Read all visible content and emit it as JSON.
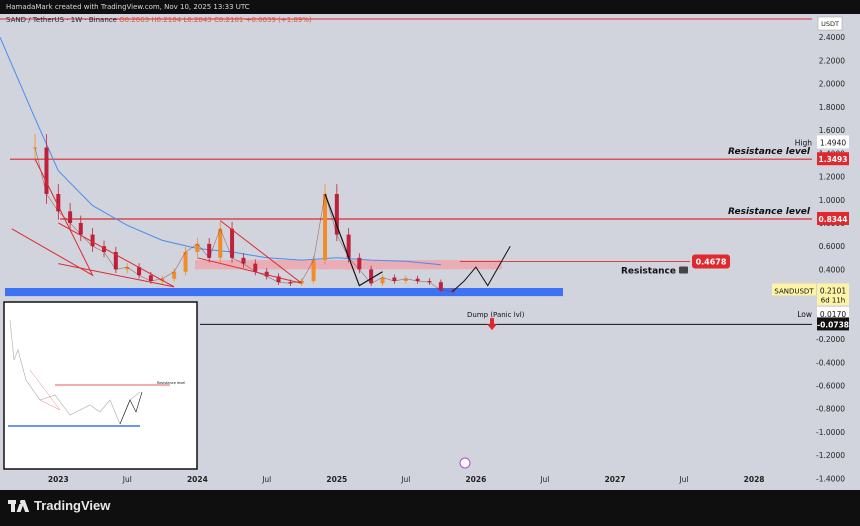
{
  "header": {
    "watermark": "HamadaMark created with TradingView.com, Nov 10, 2025 13:33 UTC",
    "symbol": "SAND / TetherUS · 1W · Binance",
    "ohlc": "O0.2063 H0.2104 L0.2043 C0.2101 +0.0039 (+1.89%)"
  },
  "footer": {
    "brand": "TradingView"
  },
  "colors": {
    "background": "#d1d4dc",
    "resistance_red": "#e0282f",
    "support_blue": "#3d72f5",
    "zone_pink": "#f2a0a8",
    "ma_blue": "#4a8cf0",
    "price_label_yellow": "#fdf3a7"
  },
  "chart_data": {
    "type": "line",
    "title": "SAND / TetherUS · 1W · Binance",
    "currency": "USDT",
    "y_ticks": [
      "2.4000",
      "2.2000",
      "2.0000",
      "1.8000",
      "1.6000",
      "1.4000",
      "1.2000",
      "1.0000",
      "0.8000",
      "0.6000",
      "0.4000",
      "0.2000",
      "0.0000",
      "-0.2000",
      "-0.4000",
      "-0.6000",
      "-0.8000",
      "-1.0000",
      "-1.2000",
      "-1.4000"
    ],
    "ylim": [
      -1.5,
      2.6
    ],
    "x_ticks": [
      "2023",
      "Jul",
      "2024",
      "Jul",
      "2025",
      "Jul",
      "2026",
      "Jul",
      "2027",
      "Jul",
      "2028"
    ],
    "price_series": {
      "x": [
        "2022-11",
        "2022-12",
        "2023-01",
        "2023-02",
        "2023-03",
        "2023-04",
        "2023-05",
        "2023-06",
        "2023-07",
        "2023-08",
        "2023-09",
        "2023-10",
        "2023-11",
        "2023-12",
        "2024-01",
        "2024-02",
        "2024-03",
        "2024-04",
        "2024-05",
        "2024-06",
        "2024-07",
        "2024-08",
        "2024-09",
        "2024-10",
        "2024-11",
        "2024-12",
        "2025-01",
        "2025-02",
        "2025-03",
        "2025-04",
        "2025-05",
        "2025-06",
        "2025-07",
        "2025-08",
        "2025-09",
        "2025-10",
        "2025-11"
      ],
      "y": [
        1.45,
        1.05,
        0.9,
        0.8,
        0.7,
        0.6,
        0.55,
        0.4,
        0.42,
        0.35,
        0.3,
        0.32,
        0.38,
        0.55,
        0.62,
        0.5,
        0.75,
        0.5,
        0.45,
        0.38,
        0.34,
        0.29,
        0.28,
        0.3,
        0.48,
        1.05,
        0.7,
        0.5,
        0.4,
        0.28,
        0.33,
        0.3,
        0.32,
        0.3,
        0.29,
        0.22,
        0.21
      ]
    },
    "moving_average": {
      "x": [
        "2022-08",
        "2022-11",
        "2023-01",
        "2023-04",
        "2023-07",
        "2023-10",
        "2024-01",
        "2024-04",
        "2024-07",
        "2024-10",
        "2025-01",
        "2025-04",
        "2025-07",
        "2025-10"
      ],
      "y": [
        2.4,
        1.7,
        1.25,
        0.95,
        0.78,
        0.65,
        0.58,
        0.55,
        0.5,
        0.48,
        0.5,
        0.48,
        0.47,
        0.44
      ]
    },
    "levels": [
      {
        "label": "Resistance level",
        "value": 1.3493,
        "price_tag": "1.3493"
      },
      {
        "label": "Resistance level",
        "value": 0.8344,
        "price_tag": "0.8344"
      },
      {
        "label": "Resistance",
        "value": 0.4678,
        "price_tag": "0.4678"
      }
    ],
    "support_zone": [
      0.17,
      0.24
    ],
    "resistance_zone": [
      0.4,
      0.48
    ],
    "projection": {
      "x": [
        "2025-11",
        "2025-12",
        "2026-01",
        "2026-02",
        "2026-04"
      ],
      "y": [
        0.21,
        0.3,
        0.42,
        0.26,
        0.6
      ]
    },
    "annotation": "Dump (Panic lvl)",
    "panic_level": {
      "value": -0.0738,
      "price_tag": "-0.0738"
    },
    "high": {
      "label": "High",
      "value": "1.4940"
    },
    "low": {
      "label": "Low",
      "value": "0.0170"
    },
    "last_price": {
      "symbol": "SANDUSDT",
      "value": "0.2101",
      "countdown": "6d 11h"
    },
    "inset_labels": [
      "Resistance level"
    ]
  }
}
